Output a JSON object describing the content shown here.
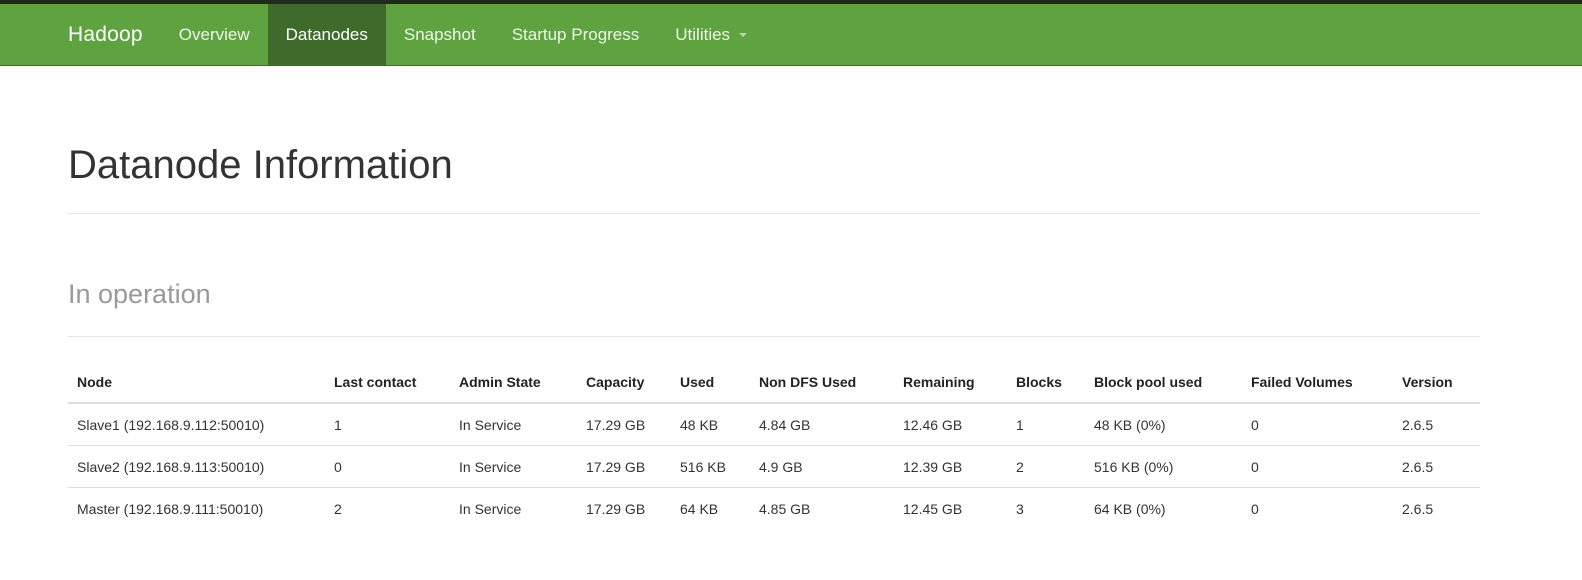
{
  "navbar": {
    "brand": "Hadoop",
    "items": [
      {
        "label": "Overview",
        "active": false
      },
      {
        "label": "Datanodes",
        "active": true
      },
      {
        "label": "Snapshot",
        "active": false
      },
      {
        "label": "Startup Progress",
        "active": false
      },
      {
        "label": "Utilities",
        "active": false,
        "has_dropdown": true
      }
    ],
    "colors": {
      "background": "#5fa341",
      "active_background": "#3e6b2b"
    }
  },
  "page": {
    "title": "Datanode Information",
    "section_title": "In operation"
  },
  "table": {
    "columns": [
      "Node",
      "Last contact",
      "Admin State",
      "Capacity",
      "Used",
      "Non DFS Used",
      "Remaining",
      "Blocks",
      "Block pool used",
      "Failed Volumes",
      "Version"
    ],
    "rows": [
      [
        "Slave1 (192.168.9.112:50010)",
        "1",
        "In Service",
        "17.29 GB",
        "48 KB",
        "4.84 GB",
        "12.46 GB",
        "1",
        "48 KB (0%)",
        "0",
        "2.6.5"
      ],
      [
        "Slave2 (192.168.9.113:50010)",
        "0",
        "In Service",
        "17.29 GB",
        "516 KB",
        "4.9 GB",
        "12.39 GB",
        "2",
        "516 KB (0%)",
        "0",
        "2.6.5"
      ],
      [
        "Master (192.168.9.111:50010)",
        "2",
        "In Service",
        "17.29 GB",
        "64 KB",
        "4.85 GB",
        "12.45 GB",
        "3",
        "64 KB (0%)",
        "0",
        "2.6.5"
      ]
    ]
  }
}
